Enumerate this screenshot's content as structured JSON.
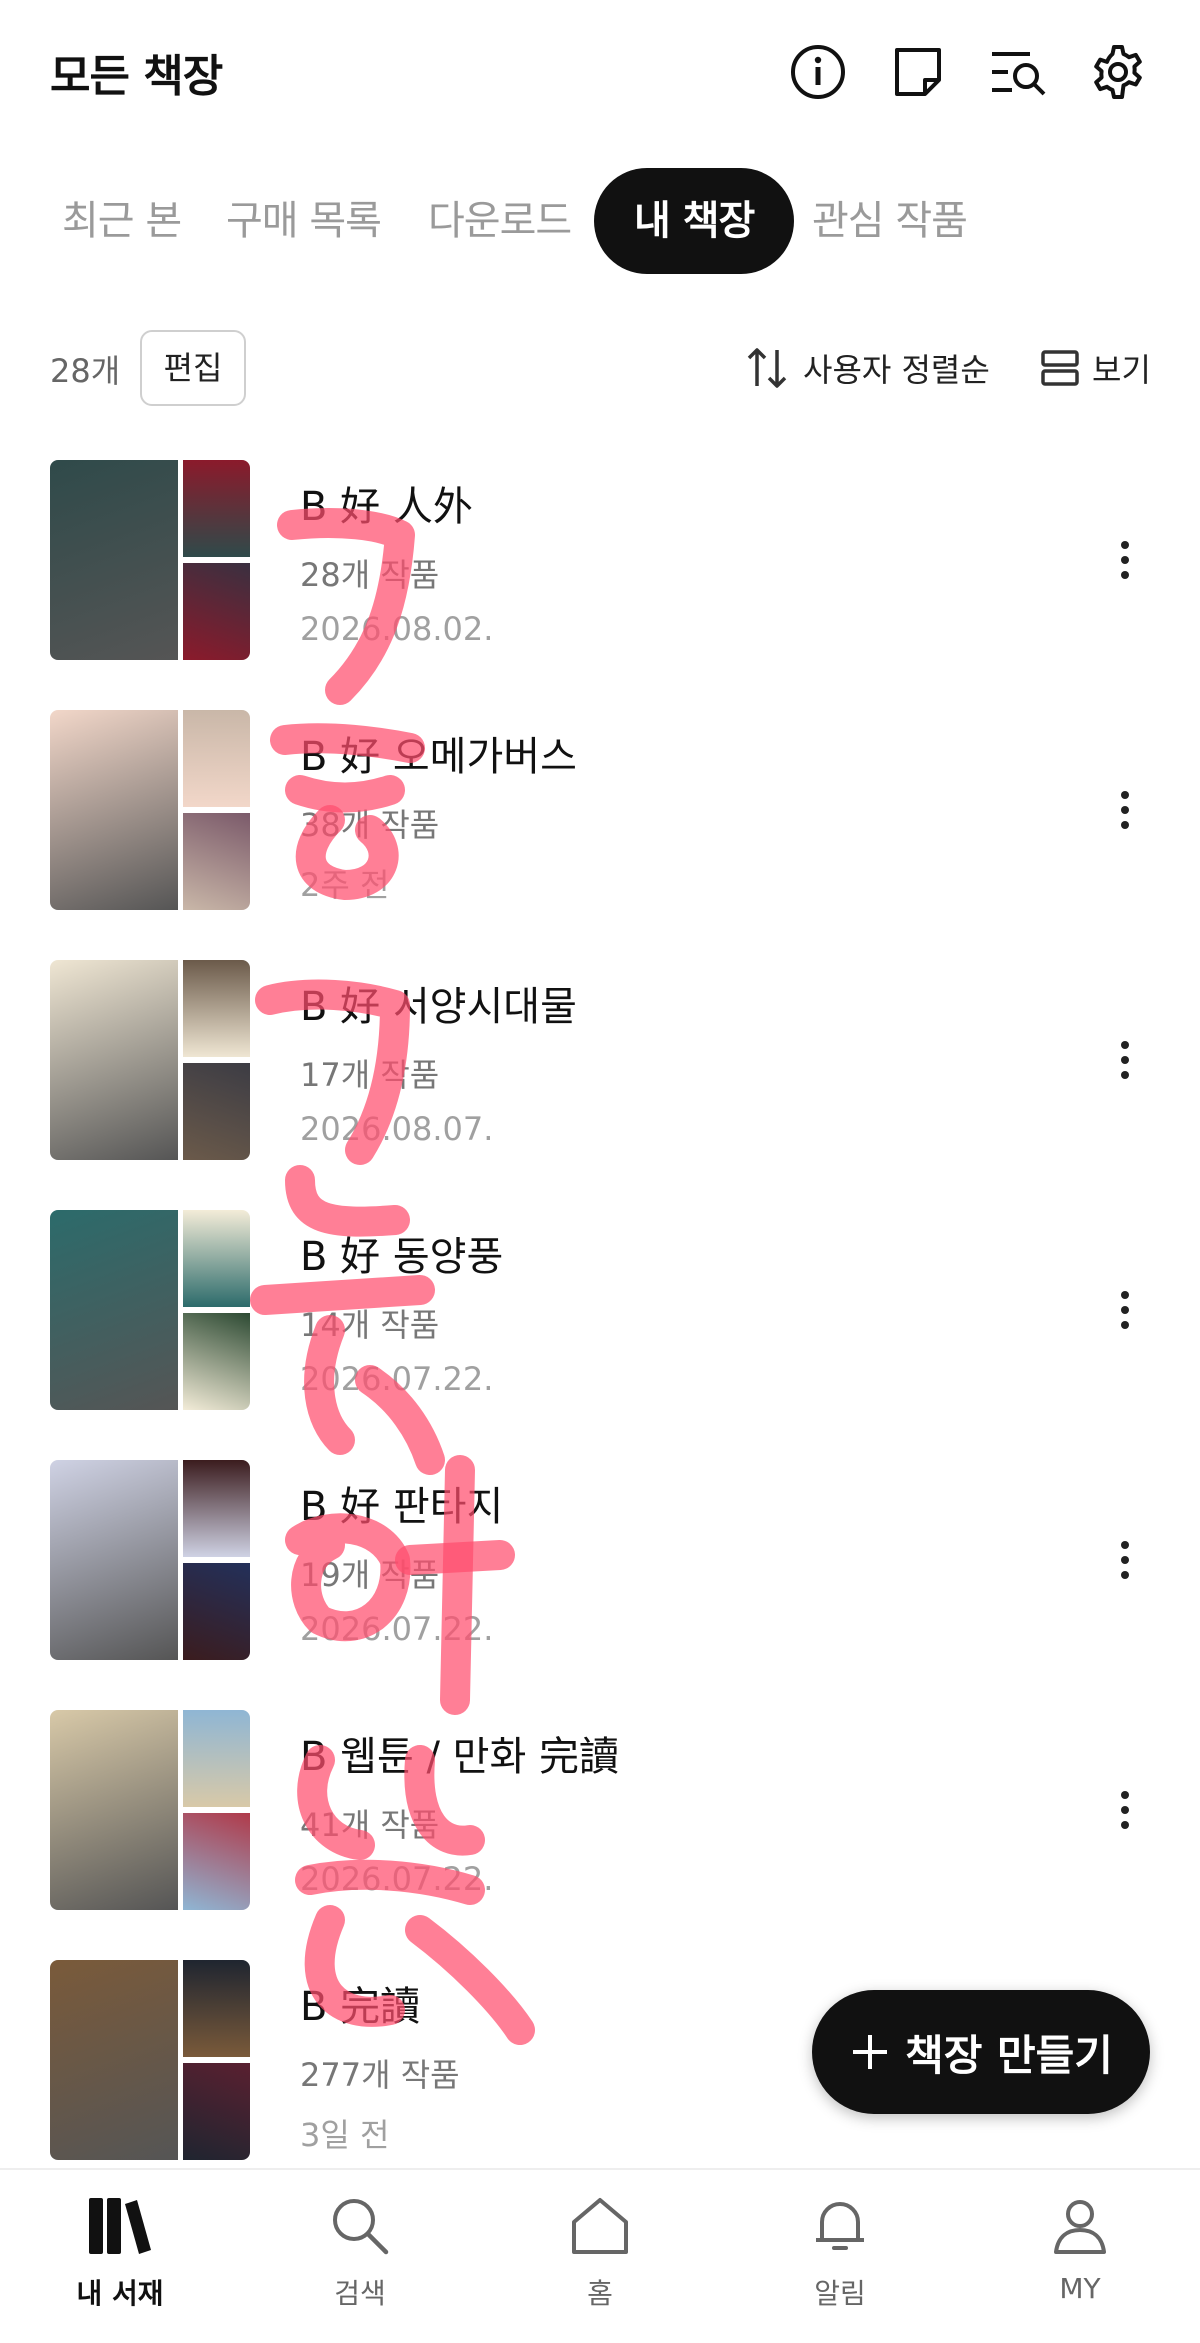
{
  "header": {
    "title": "모든 책장",
    "icons": [
      "info-icon",
      "note-icon",
      "search-list-icon",
      "gear-icon"
    ]
  },
  "tabs": [
    {
      "label": "최근 본",
      "active": false
    },
    {
      "label": "구매 목록",
      "active": false
    },
    {
      "label": "다운로드",
      "active": false
    },
    {
      "label": "내 책장",
      "active": true
    },
    {
      "label": "관심 작품",
      "active": false
    }
  ],
  "toolbar": {
    "count": "28개",
    "edit_label": "편집",
    "sort_label": "사용자 정렬순",
    "view_label": "보기"
  },
  "shelves": [
    {
      "name": "B 好 人外",
      "count": "28개 작품",
      "date": "2026.08.02.",
      "colors": [
        "#2f4a4a",
        "#8b1a2b",
        "#3a3040"
      ]
    },
    {
      "name": "B 好 오메가버스",
      "count": "38개 작품",
      "date": "2주 전",
      "colors": [
        "#f2d7c9",
        "#c9b7a8",
        "#7b5a6a"
      ]
    },
    {
      "name": "B 好 서양시대물",
      "count": "17개 작품",
      "date": "2026.08.07.",
      "colors": [
        "#efe6d3",
        "#6b5a4a",
        "#3c3c44"
      ]
    },
    {
      "name": "B 好 동양풍",
      "count": "14개 작품",
      "date": "2026.07.22.",
      "colors": [
        "#2c6b6b",
        "#f3ecd8",
        "#2d4a33"
      ]
    },
    {
      "name": "B 好 판타지",
      "count": "19개 작품",
      "date": "2026.07.22.",
      "colors": [
        "#cfd2e4",
        "#3b1c1e",
        "#23305a"
      ]
    },
    {
      "name": "B 웹툰 / 만화 完讀",
      "count": "41개 작품",
      "date": "2026.07.22.",
      "colors": [
        "#d8c9a8",
        "#8fb6d4",
        "#b03a4a"
      ]
    },
    {
      "name": "B 完讀",
      "count": "277개 작품",
      "date": "3일 전",
      "colors": [
        "#7a5a3a",
        "#1f2530",
        "#5a2030"
      ]
    }
  ],
  "fab": {
    "label": "책장 만들기"
  },
  "bottom_nav": [
    {
      "label": "내 서재",
      "icon": "library-icon",
      "active": true
    },
    {
      "label": "검색",
      "icon": "search-icon",
      "active": false
    },
    {
      "label": "홈",
      "icon": "home-icon",
      "active": false
    },
    {
      "label": "알림",
      "icon": "bell-icon",
      "active": false
    },
    {
      "label": "MY",
      "icon": "person-icon",
      "active": false
    }
  ],
  "colors": {
    "accent": "#111111",
    "inactive_text": "#9a9a9a",
    "scribble": "#ff4d6d"
  }
}
